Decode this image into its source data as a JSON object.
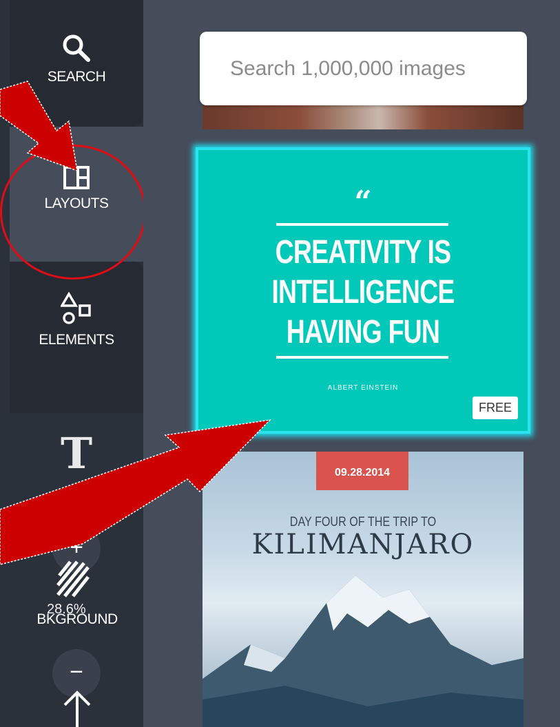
{
  "sidebar": {
    "items": [
      {
        "label": "SEARCH",
        "icon": "search-icon"
      },
      {
        "label": "LAYOUTS",
        "icon": "layouts-icon"
      },
      {
        "label": "ELEMENTS",
        "icon": "shapes-icon"
      },
      {
        "label": "BKGROUND",
        "icon": "background-icon"
      }
    ],
    "text_icon_glyph": "T",
    "zoom": {
      "plus": "+",
      "minus": "−",
      "value": "28.6%"
    }
  },
  "search": {
    "placeholder": "Search 1,000,000 images"
  },
  "layouts": [
    {
      "quote_mark": "“",
      "quote_text": "CREATIVITY IS INTELLIGENCE HAVING FUN",
      "author": "ALBERT EINSTEIN",
      "badge": "FREE",
      "background": "#00c9ba"
    },
    {
      "date": "09.28.2014",
      "subtitle": "DAY FOUR OF THE TRIP TO",
      "title": "KILIMANJARO"
    }
  ],
  "colors": {
    "sidebar": "#2b313b",
    "panel": "#454c5a",
    "annotation": "#e00d17",
    "highlight": "#2be3f0"
  }
}
